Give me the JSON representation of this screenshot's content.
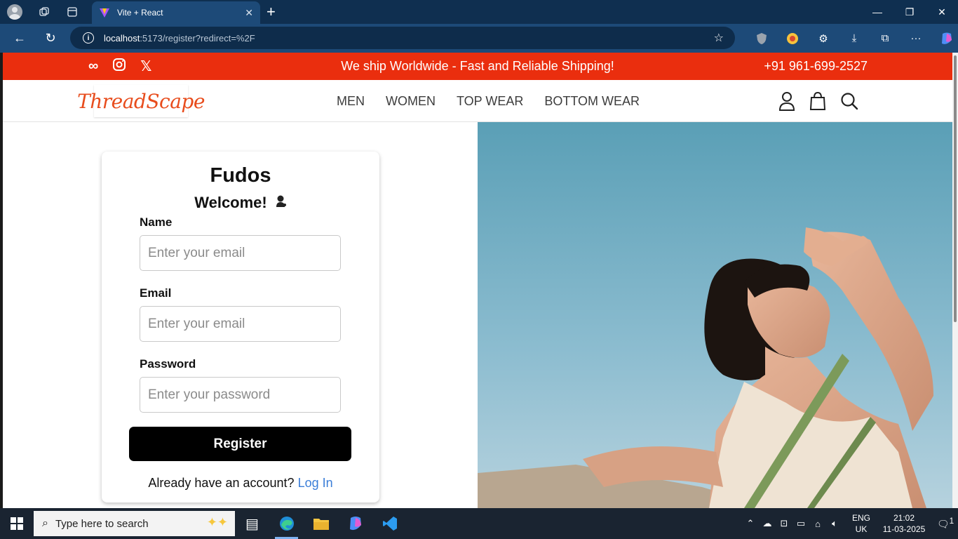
{
  "browser": {
    "tab_title": "Vite + React",
    "url_host": "localhost",
    "url_path": ":5173/register?redirect=%2F"
  },
  "promo": {
    "message": "We ship Worldwide - Fast and Reliable Shipping!",
    "phone": "+91 961-699-2527",
    "social_icons": [
      "meta-icon",
      "instagram-icon",
      "x-icon"
    ]
  },
  "nav": {
    "logo": "ThreadScape",
    "menu": [
      "MEN",
      "WOMEN",
      "TOP WEAR",
      "BOTTOM WEAR"
    ]
  },
  "form": {
    "brand": "Fudos",
    "welcome": "Welcome!",
    "fields": [
      {
        "label": "Name",
        "placeholder": "Enter your email"
      },
      {
        "label": "Email",
        "placeholder": "Enter your email"
      },
      {
        "label": "Password",
        "placeholder": "Enter your password"
      }
    ],
    "submit": "Register",
    "login_prompt": "Already have an account?",
    "login_link": "Log In"
  },
  "taskbar": {
    "search_placeholder": "Type here to search",
    "lang_top": "ENG",
    "lang_bottom": "UK",
    "time": "21:02",
    "date": "11-03-2025",
    "notification_count": "1"
  },
  "colors": {
    "promo_bg": "#ea2e0e",
    "logo": "#e84c1c",
    "link": "#3b7ed8",
    "button": "#000000"
  }
}
